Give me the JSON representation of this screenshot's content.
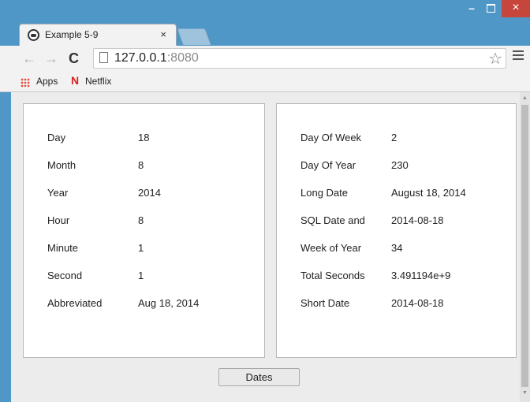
{
  "browser": {
    "tab": {
      "title": "Example 5-9",
      "close": "×",
      "favicon": "chrome-app-icon"
    },
    "window_controls": {
      "minimize": "–",
      "close": "×"
    },
    "nav": {
      "back": "←",
      "forward": "→",
      "reload": "C"
    },
    "url": {
      "host": "127.0.0.1",
      "port": ":8080"
    },
    "star": "☆",
    "bookmarks": [
      {
        "label": "Apps",
        "icon": "apps-grid-icon"
      },
      {
        "label": "Netflix",
        "icon": "netflix-icon",
        "glyph": "N"
      }
    ]
  },
  "left_panel": {
    "rows": [
      {
        "label": "Day",
        "value": "18"
      },
      {
        "label": "Month",
        "value": "8"
      },
      {
        "label": "Year",
        "value": "2014"
      },
      {
        "label": "Hour",
        "value": "8"
      },
      {
        "label": "Minute",
        "value": "1"
      },
      {
        "label": "Second",
        "value": "1"
      },
      {
        "label": "Abbreviated",
        "value": "Aug 18, 2014"
      }
    ]
  },
  "right_panel": {
    "rows": [
      {
        "label": "Day Of Week",
        "value": "2"
      },
      {
        "label": "Day Of Year",
        "value": "230"
      },
      {
        "label": "Long Date",
        "value": "August 18, 2014"
      },
      {
        "label": "SQL Date and",
        "value": "2014-08-18"
      },
      {
        "label": "Week of Year",
        "value": "34"
      },
      {
        "label": "Total Seconds",
        "value": "3.491194e+9"
      },
      {
        "label": "Short Date",
        "value": "2014-08-18"
      }
    ]
  },
  "actions": {
    "dates_button": "Dates"
  },
  "colors": {
    "window_frame": "#4f97c6",
    "close_button": "#c7463c",
    "netflix": "#d81f26"
  }
}
